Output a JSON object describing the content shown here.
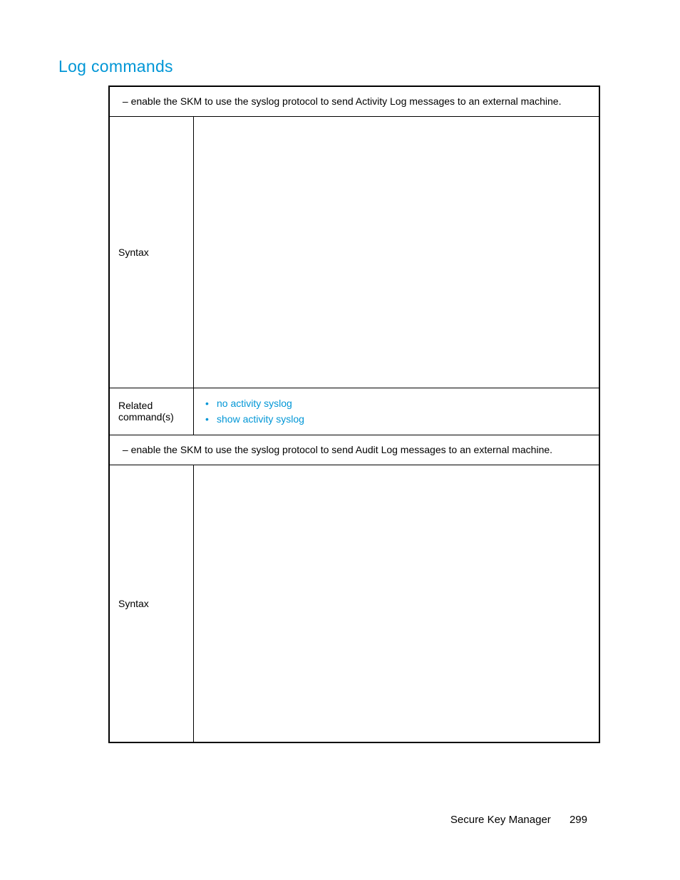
{
  "title": "Log commands",
  "activity_desc": " – enable the SKM to use the syslog protocol to send Activity Log messages to an external machine.",
  "syntax_label": "Syntax",
  "related_label": "Related command(s)",
  "related_items": {
    "item1": "no activity syslog",
    "item2": "show activity syslog"
  },
  "audit_desc": " – enable the SKM to use the syslog protocol to send Audit Log messages to an external machine.",
  "footer_text": "Secure Key Manager",
  "page_number": "299"
}
